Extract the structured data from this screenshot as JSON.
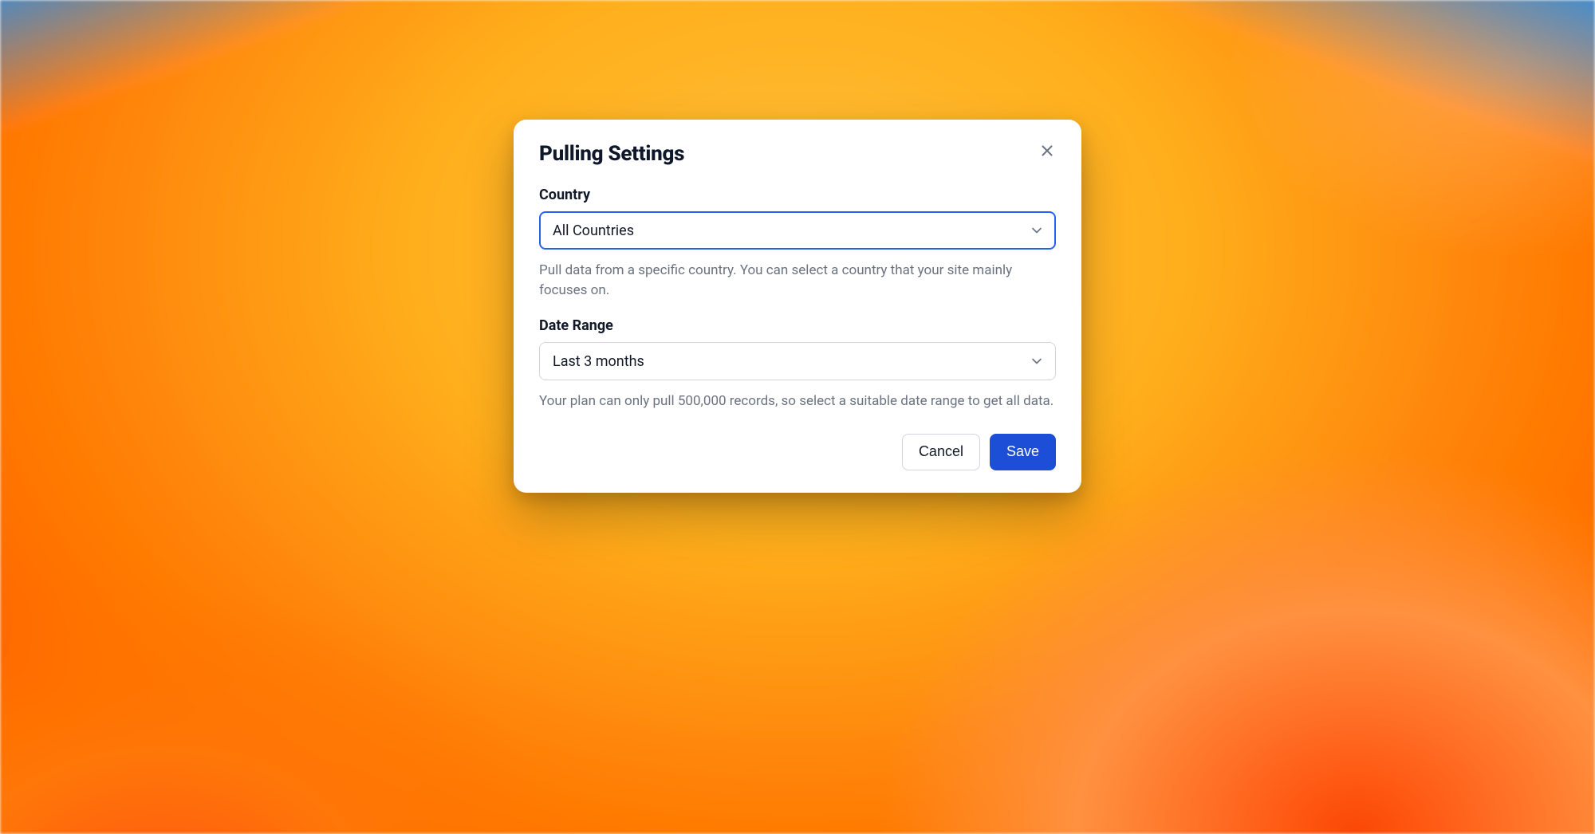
{
  "dialog": {
    "title": "Pulling Settings",
    "country": {
      "label": "Country",
      "selected": "All Countries",
      "help": "Pull data from a specific country. You can select a country that your site mainly focuses on."
    },
    "date_range": {
      "label": "Date Range",
      "selected": "Last 3 months",
      "help": "Your plan can only pull 500,000 records, so select a suitable date range to get all data."
    },
    "actions": {
      "cancel": "Cancel",
      "save": "Save"
    }
  }
}
